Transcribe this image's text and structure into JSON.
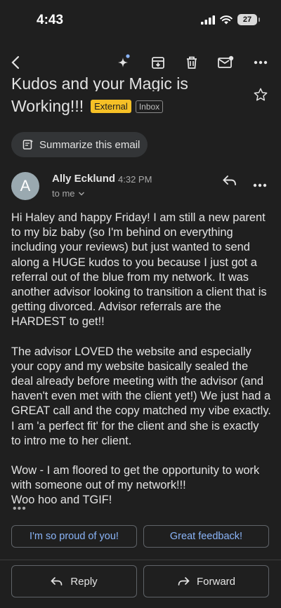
{
  "status": {
    "time": "4:43",
    "battery": "27"
  },
  "toolbar": {
    "icons": [
      "back-arrow-icon",
      "sparkle-icon",
      "archive-icon",
      "delete-icon",
      "mark-unread-icon",
      "more-icon"
    ]
  },
  "email": {
    "subject_line1": "Kudos and your Magic is",
    "subject_line2": "Working!!!",
    "badge_external": "External",
    "badge_inbox": "Inbox",
    "summarize_label": "Summarize this email",
    "sender_initial": "A",
    "sender_name": "Ally Ecklund",
    "time": "4:32 PM",
    "to": "to me",
    "body": [
      "Hi Haley and happy Friday! I am still a new parent to my biz baby (so I'm behind on everything including your reviews) but just wanted to send along a HUGE kudos to you because I just got a referral out of the blue from my network. It was another advisor looking to transition a client that is getting divorced. Advisor referrals are the HARDEST to get!!",
      "The advisor LOVED the website and especially your copy and my website basically sealed the deal already before meeting with the advisor (and haven't even met with the client yet!) We just had a GREAT call and the copy matched my vibe exactly. I am 'a perfect fit' for the client and she is exactly to intro me to her client.",
      "Wow - I am floored to get the opportunity to work with someone out of my network!!!",
      "Woo hoo and TGIF!"
    ],
    "ellipsis": "•••"
  },
  "smart_replies": [
    "I'm so proud of you!",
    "Great feedback!"
  ],
  "actions": {
    "reply": "Reply",
    "forward": "Forward"
  },
  "colors": {
    "background": "#1f1f1f",
    "accent": "#8ab4f8",
    "external_badge": "#f6c026",
    "avatar": "#9aa9b0"
  }
}
